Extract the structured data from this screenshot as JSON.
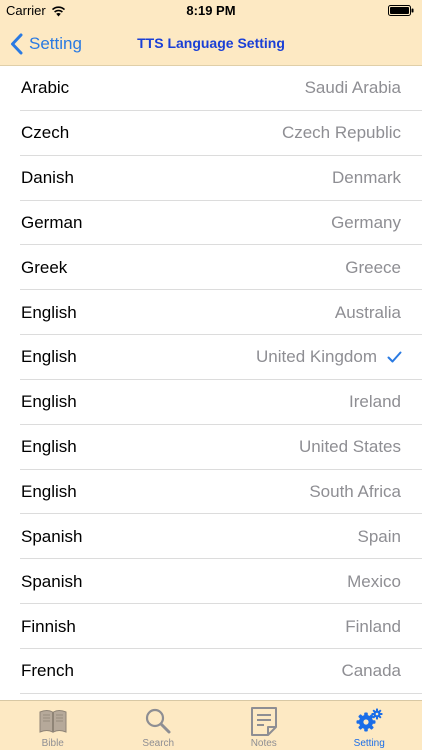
{
  "status_bar": {
    "carrier": "Carrier",
    "time": "8:19 PM"
  },
  "nav": {
    "back_label": "Setting",
    "title": "TTS Language Setting"
  },
  "languages": [
    {
      "language": "Arabic",
      "region": "Saudi Arabia",
      "selected": false
    },
    {
      "language": "Czech",
      "region": "Czech Republic",
      "selected": false
    },
    {
      "language": "Danish",
      "region": "Denmark",
      "selected": false
    },
    {
      "language": "German",
      "region": "Germany",
      "selected": false
    },
    {
      "language": "Greek",
      "region": "Greece",
      "selected": false
    },
    {
      "language": "English",
      "region": "Australia",
      "selected": false
    },
    {
      "language": "English",
      "region": "United Kingdom",
      "selected": true
    },
    {
      "language": "English",
      "region": "Ireland",
      "selected": false
    },
    {
      "language": "English",
      "region": "United States",
      "selected": false
    },
    {
      "language": "English",
      "region": "South Africa",
      "selected": false
    },
    {
      "language": "Spanish",
      "region": "Spain",
      "selected": false
    },
    {
      "language": "Spanish",
      "region": "Mexico",
      "selected": false
    },
    {
      "language": "Finnish",
      "region": "Finland",
      "selected": false
    },
    {
      "language": "French",
      "region": "Canada",
      "selected": false
    }
  ],
  "tab_bar": {
    "tabs": [
      {
        "label": "Bible",
        "icon": "book-icon",
        "active": false
      },
      {
        "label": "Search",
        "icon": "search-icon",
        "active": false
      },
      {
        "label": "Notes",
        "icon": "notes-icon",
        "active": false
      },
      {
        "label": "Setting",
        "icon": "gear-icon",
        "active": true
      }
    ]
  },
  "colors": {
    "bar_background": "#fde9c3",
    "accent": "#2a7ae2",
    "title": "#1a3fd6",
    "active_tab": "#1a6de8",
    "inactive_tab": "#8e8e93"
  }
}
